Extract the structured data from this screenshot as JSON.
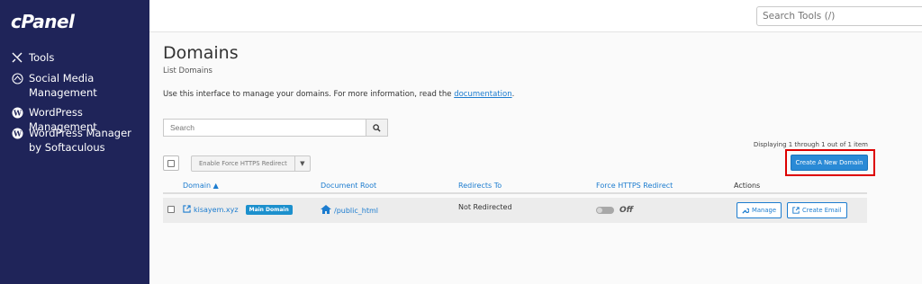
{
  "sidebar": {
    "logo": "cPanel",
    "items": [
      {
        "icon": "tools-icon",
        "label": "Tools"
      },
      {
        "icon": "social-media-icon",
        "label": "Social Media Management"
      },
      {
        "icon": "wordpress-icon",
        "label": "WordPress Management"
      },
      {
        "icon": "wordpress-icon",
        "label": "WordPress Manager by Softaculous"
      }
    ]
  },
  "topbar": {
    "search_placeholder": "Search Tools (/)"
  },
  "page": {
    "title": "Domains",
    "subtitle": "List Domains",
    "intro_text": "Use this interface to manage your domains. For more information, read the ",
    "intro_link": "documentation",
    "intro_end": "."
  },
  "search": {
    "placeholder": "Search"
  },
  "toolbar": {
    "force_https_label": "Enable Force HTTPS Redirect",
    "displaying": "Displaying 1 through 1 out of 1 item",
    "create_label": "Create A New Domain"
  },
  "table": {
    "headers": {
      "domain": "Domain",
      "document_root": "Document Root",
      "redirects_to": "Redirects To",
      "force_https": "Force HTTPS Redirect",
      "actions": "Actions"
    },
    "rows": [
      {
        "domain": "kisayem.xyz",
        "badge": "Main Domain",
        "document_root": "/public_html",
        "redirects_to": "Not Redirected",
        "force_https": "Off",
        "manage_label": "Manage",
        "create_email_label": "Create Email"
      }
    ]
  },
  "colors": {
    "sidebar_bg": "#1f2459",
    "link": "#1c7ccf",
    "primary_button": "#2a8ad6",
    "highlight": "#dd0000"
  }
}
